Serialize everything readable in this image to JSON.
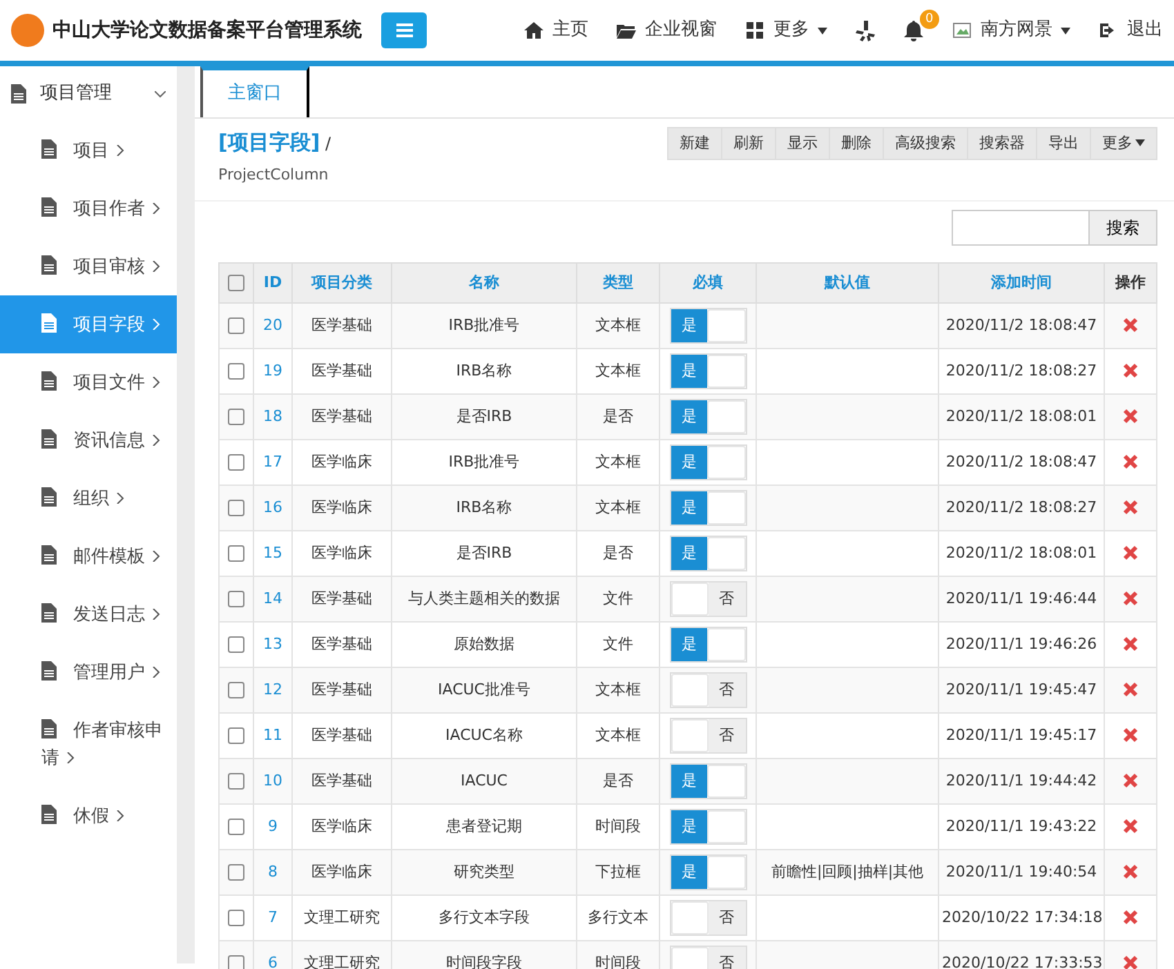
{
  "header": {
    "title": "中山大学论文数据备案平台管理系统",
    "nav": [
      {
        "kind": "home",
        "label": "主页"
      },
      {
        "kind": "folder",
        "label": "企业视窗"
      },
      {
        "kind": "grid",
        "label": "更多",
        "caret": true
      },
      {
        "kind": "yelp"
      },
      {
        "kind": "bell",
        "badge": "0"
      },
      {
        "kind": "user",
        "label": "南方网景",
        "caret": true
      },
      {
        "kind": "logout",
        "label": "退出"
      }
    ]
  },
  "sidebar": {
    "group": {
      "label": "项目管理",
      "expanded": true
    },
    "items": [
      {
        "label": "项目",
        "selected": false
      },
      {
        "label": "项目作者",
        "selected": false
      },
      {
        "label": "项目审核",
        "selected": false
      },
      {
        "label": "项目字段",
        "selected": true
      },
      {
        "label": "项目文件",
        "selected": false
      },
      {
        "label": "资讯信息",
        "selected": false
      },
      {
        "label": "组织",
        "selected": false
      },
      {
        "label": "邮件模板",
        "selected": false
      },
      {
        "label": "发送日志",
        "selected": false
      },
      {
        "label": "管理用户",
        "selected": false
      },
      {
        "label": "作者审核申请",
        "selected": false
      },
      {
        "label": "休假",
        "selected": false
      }
    ]
  },
  "tabs": [
    {
      "label": "主窗口",
      "selected": true
    }
  ],
  "page": {
    "title": "[项目字段]",
    "separator": "/",
    "subtitle": "ProjectColumn"
  },
  "toolbar": [
    "新建",
    "刷新",
    "显示",
    "删除",
    "高级搜索",
    "搜索器",
    "导出",
    "更多"
  ],
  "search": {
    "button": "搜索"
  },
  "table": {
    "select_all": {
      "checked": false
    },
    "columns": [
      "ID",
      "项目分类",
      "名称",
      "类型",
      "必填",
      "默认值",
      "添加时间",
      "操作"
    ],
    "rows": [
      {
        "id": "20",
        "category": "医学基础",
        "name": "IRB批准号",
        "type": "文本框",
        "required": true,
        "required_text": "是",
        "time": "2020/11/2 18:08:47",
        "checked": false
      },
      {
        "id": "19",
        "category": "医学基础",
        "name": "IRB名称",
        "type": "文本框",
        "required": true,
        "required_text": "是",
        "time": "2020/11/2 18:08:27",
        "checked": false
      },
      {
        "id": "18",
        "category": "医学基础",
        "name": "是否IRB",
        "type": "是否",
        "required": true,
        "required_text": "是",
        "time": "2020/11/2 18:08:01",
        "checked": false
      },
      {
        "id": "17",
        "category": "医学临床",
        "name": "IRB批准号",
        "type": "文本框",
        "required": true,
        "required_text": "是",
        "time": "2020/11/2 18:08:47",
        "checked": false
      },
      {
        "id": "16",
        "category": "医学临床",
        "name": "IRB名称",
        "type": "文本框",
        "required": true,
        "required_text": "是",
        "time": "2020/11/2 18:08:27",
        "checked": false
      },
      {
        "id": "15",
        "category": "医学临床",
        "name": "是否IRB",
        "type": "是否",
        "required": true,
        "required_text": "是",
        "time": "2020/11/2 18:08:01",
        "checked": false
      },
      {
        "id": "14",
        "category": "医学基础",
        "name": "与人类主题相关的数据",
        "type": "文件",
        "required": false,
        "required_text": "否",
        "time": "2020/11/1 19:46:44",
        "checked": false
      },
      {
        "id": "13",
        "category": "医学基础",
        "name": "原始数据",
        "type": "文件",
        "required": true,
        "required_text": "是",
        "time": "2020/11/1 19:46:26",
        "checked": false
      },
      {
        "id": "12",
        "category": "医学基础",
        "name": "IACUC批准号",
        "type": "文本框",
        "required": false,
        "required_text": "否",
        "time": "2020/11/1 19:45:47",
        "checked": false
      },
      {
        "id": "11",
        "category": "医学基础",
        "name": "IACUC名称",
        "type": "文本框",
        "required": false,
        "required_text": "否",
        "time": "2020/11/1 19:45:17",
        "checked": false
      },
      {
        "id": "10",
        "category": "医学基础",
        "name": "IACUC",
        "type": "是否",
        "required": true,
        "required_text": "是",
        "time": "2020/11/1 19:44:42",
        "checked": false
      },
      {
        "id": "9",
        "category": "医学临床",
        "name": "患者登记期",
        "type": "时间段",
        "required": true,
        "required_text": "是",
        "time": "2020/11/1 19:43:22",
        "checked": false
      },
      {
        "id": "8",
        "category": "医学临床",
        "name": "研究类型",
        "type": "下拉框",
        "required": true,
        "required_text": "是",
        "default": "前瞻性|回顾|抽样|其他",
        "time": "2020/11/1 19:40:54",
        "checked": false
      },
      {
        "id": "7",
        "category": "文理工研究",
        "name": "多行文本字段",
        "type": "多行文本",
        "required": false,
        "required_text": "否",
        "time": "2020/10/22 17:34:18",
        "checked": false
      },
      {
        "id": "6",
        "category": "文理工研究",
        "name": "时间段字段",
        "type": "时间段",
        "required": false,
        "required_text": "否",
        "time": "2020/10/22 17:33:53",
        "checked": false
      }
    ]
  }
}
